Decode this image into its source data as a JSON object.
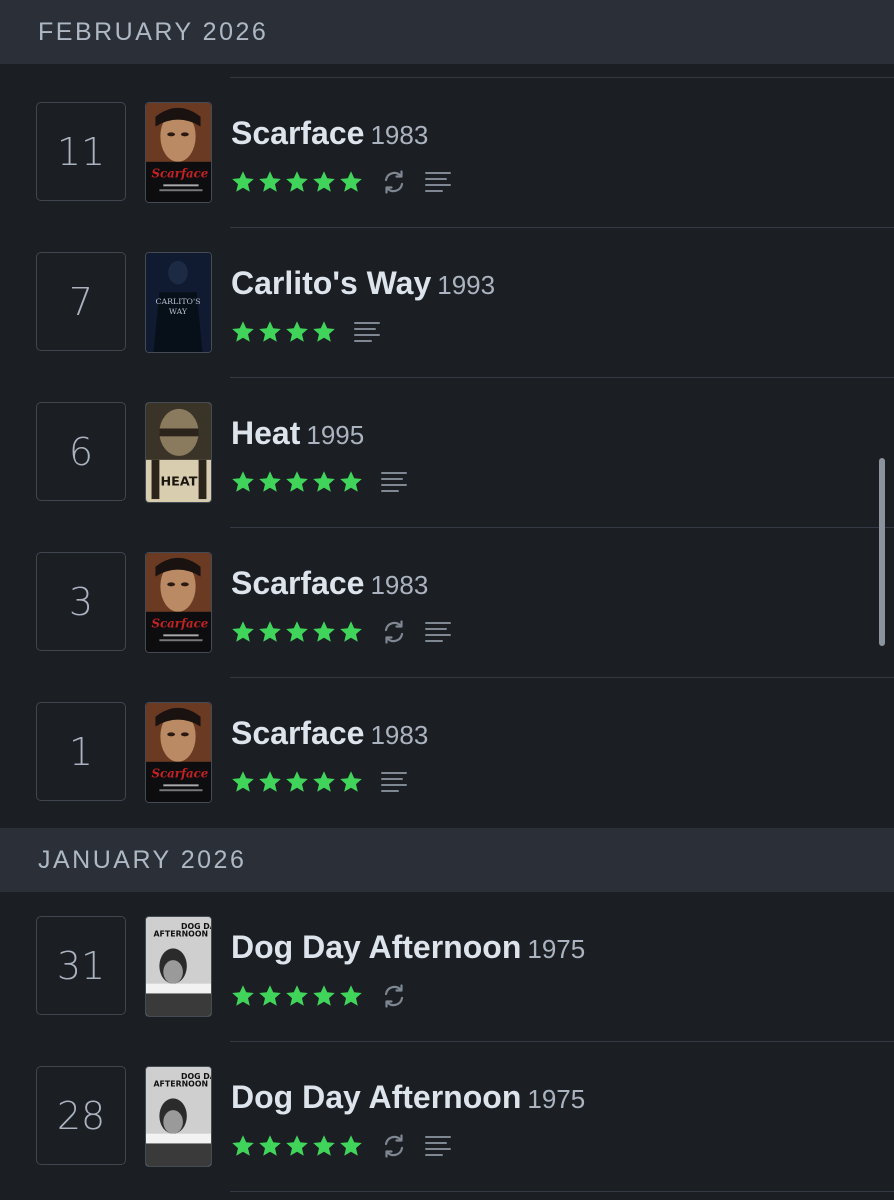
{
  "months": [
    {
      "label": "FEBRUARY 2026"
    },
    {
      "label": "JANUARY 2026"
    }
  ],
  "entries": [
    {
      "day": "11",
      "title": "Scarface",
      "year": "1983",
      "stars": 5,
      "rewatch": true,
      "review": true,
      "poster": "scarface"
    },
    {
      "day": "7",
      "title": "Carlito's Way",
      "year": "1993",
      "stars": 4,
      "rewatch": false,
      "review": true,
      "poster": "carlitos-way"
    },
    {
      "day": "6",
      "title": "Heat",
      "year": "1995",
      "stars": 5,
      "rewatch": false,
      "review": true,
      "poster": "heat"
    },
    {
      "day": "3",
      "title": "Scarface",
      "year": "1983",
      "stars": 5,
      "rewatch": true,
      "review": true,
      "poster": "scarface"
    },
    {
      "day": "1",
      "title": "Scarface",
      "year": "1983",
      "stars": 5,
      "rewatch": false,
      "review": true,
      "poster": "scarface"
    },
    {
      "day": "31",
      "title": "Dog Day Afternoon",
      "year": "1975",
      "stars": 5,
      "rewatch": true,
      "review": false,
      "poster": "dog-day-afternoon"
    },
    {
      "day": "28",
      "title": "Dog Day Afternoon",
      "year": "1975",
      "stars": 5,
      "rewatch": true,
      "review": true,
      "poster": "dog-day-afternoon"
    }
  ],
  "poster_text": {
    "scarface": "Scarface",
    "carlitos-way": "CARLITO'S WAY",
    "heat": "HEAT",
    "dog-day-afternoon": "DOG DAY AFTERNOON"
  },
  "colors": {
    "background": "#1b1e23",
    "header": "#2b3038",
    "star": "#40d45a",
    "icon": "#7e8792"
  },
  "icons": {
    "star": "star-icon",
    "rewatch": "rewatch-icon",
    "review": "review-icon"
  }
}
